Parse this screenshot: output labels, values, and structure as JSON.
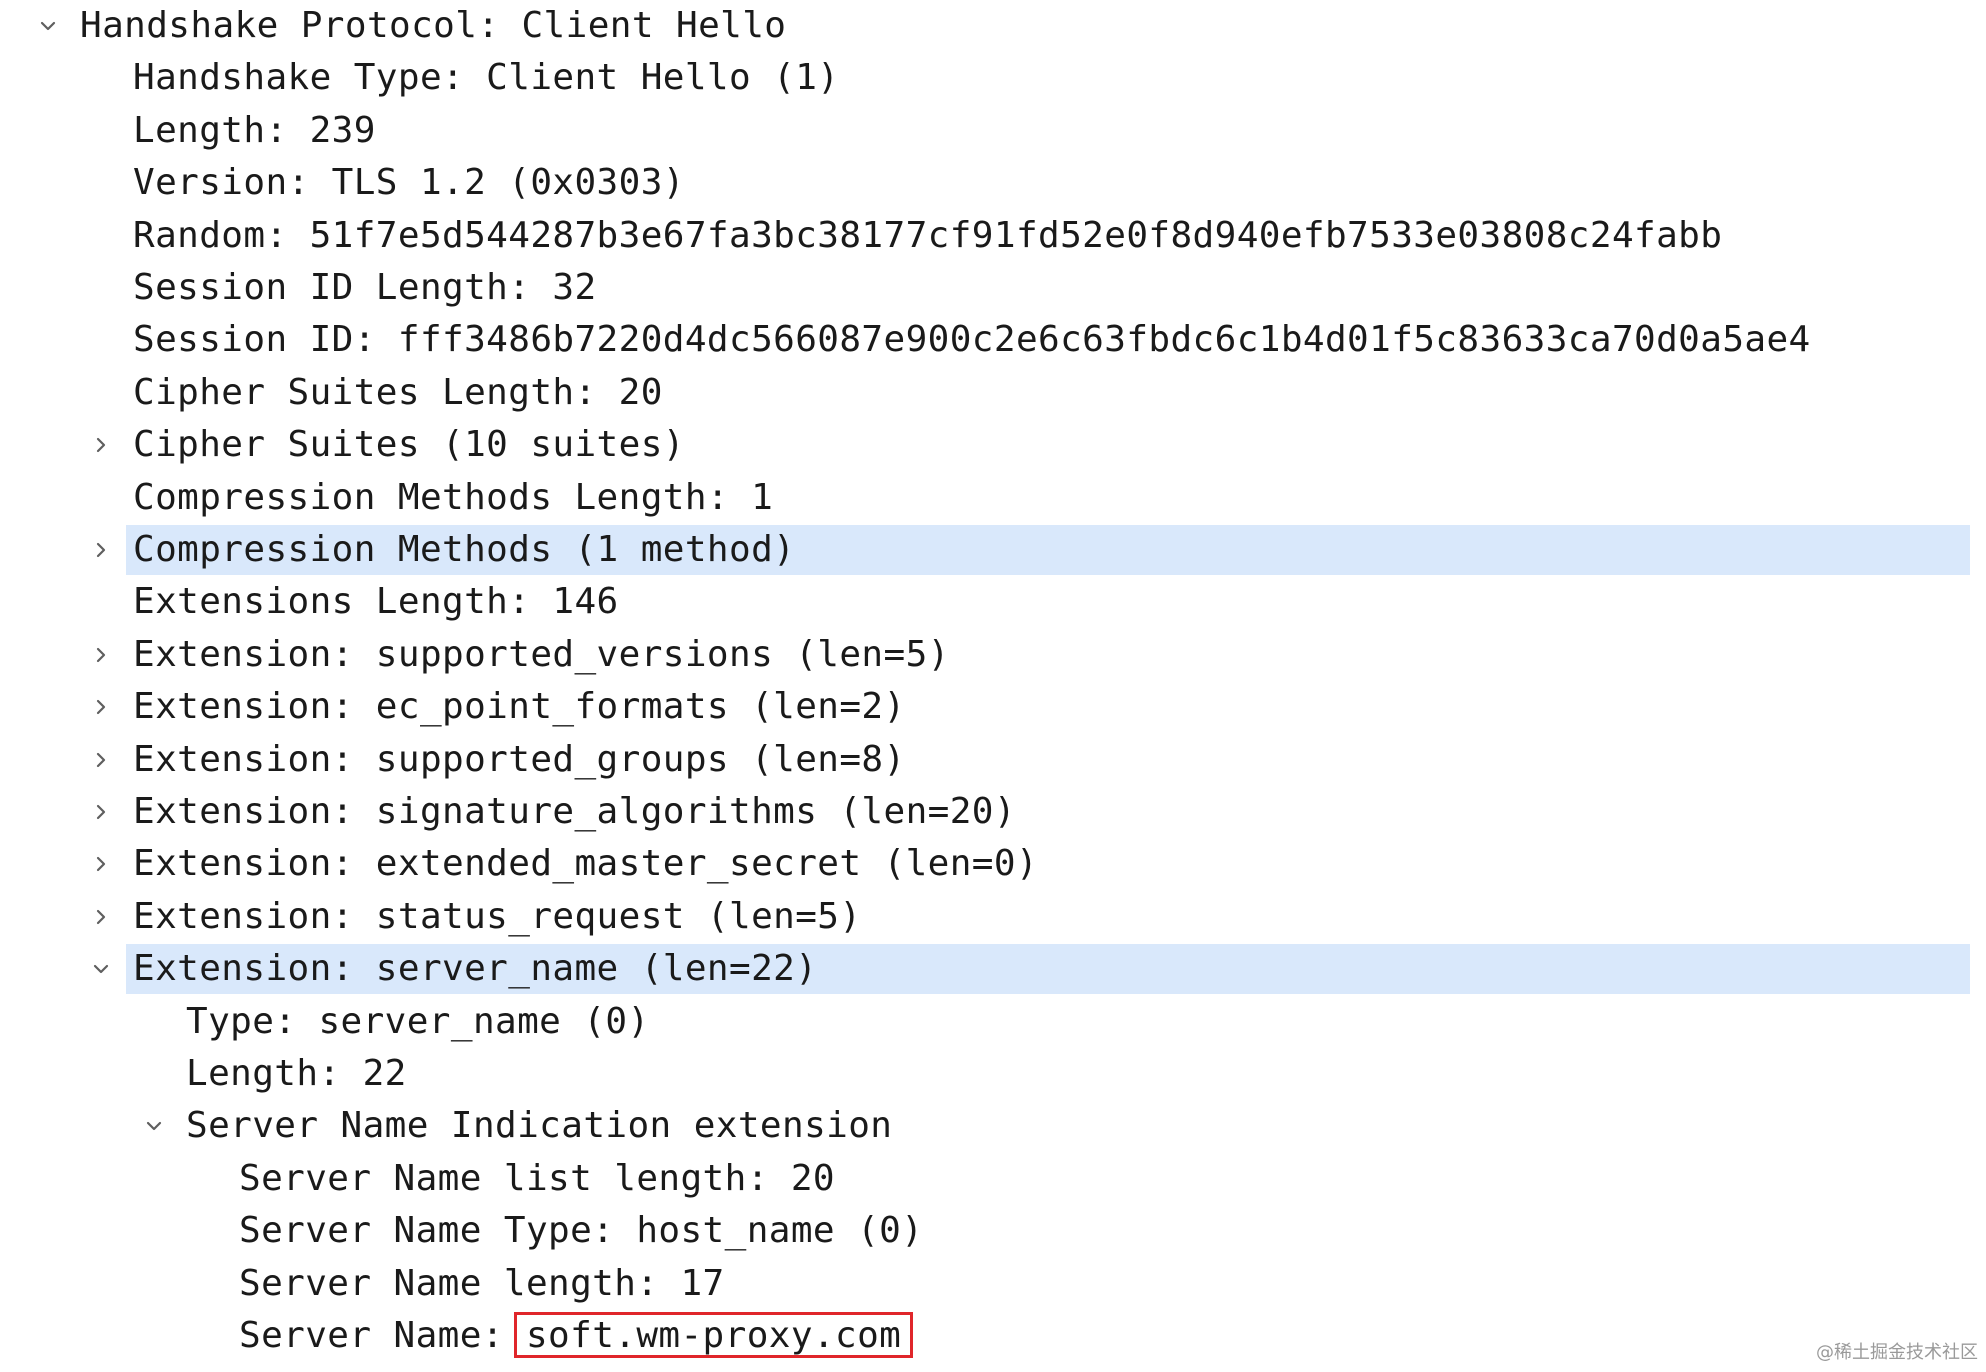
{
  "tree": [
    {
      "level": 0,
      "text": "Handshake Protocol: Client Hello",
      "toggle": "expanded",
      "selected": false
    },
    {
      "level": 1,
      "text": "Handshake Type: Client Hello (1)",
      "toggle": "none",
      "selected": false
    },
    {
      "level": 1,
      "text": "Length: 239",
      "toggle": "none",
      "selected": false
    },
    {
      "level": 1,
      "text": "Version: TLS 1.2 (0x0303)",
      "toggle": "none",
      "selected": false
    },
    {
      "level": 1,
      "text": "Random: 51f7e5d544287b3e67fa3bc38177cf91fd52e0f8d940efb7533e03808c24fabb",
      "toggle": "none",
      "selected": false
    },
    {
      "level": 1,
      "text": "Session ID Length: 32",
      "toggle": "none",
      "selected": false
    },
    {
      "level": 1,
      "text": "Session ID: fff3486b7220d4dc566087e900c2e6c63fbdc6c1b4d01f5c83633ca70d0a5ae4",
      "toggle": "none",
      "selected": false
    },
    {
      "level": 1,
      "text": "Cipher Suites Length: 20",
      "toggle": "none",
      "selected": false
    },
    {
      "level": 1,
      "text": "Cipher Suites (10 suites)",
      "toggle": "collapsed",
      "selected": false
    },
    {
      "level": 1,
      "text": "Compression Methods Length: 1",
      "toggle": "none",
      "selected": false
    },
    {
      "level": 1,
      "text": "Compression Methods (1 method)",
      "toggle": "collapsed",
      "selected": true
    },
    {
      "level": 1,
      "text": "Extensions Length: 146",
      "toggle": "none",
      "selected": false
    },
    {
      "level": 1,
      "text": "Extension: supported_versions (len=5)",
      "toggle": "collapsed",
      "selected": false
    },
    {
      "level": 1,
      "text": "Extension: ec_point_formats (len=2)",
      "toggle": "collapsed",
      "selected": false
    },
    {
      "level": 1,
      "text": "Extension: supported_groups (len=8)",
      "toggle": "collapsed",
      "selected": false
    },
    {
      "level": 1,
      "text": "Extension: signature_algorithms (len=20)",
      "toggle": "collapsed",
      "selected": false
    },
    {
      "level": 1,
      "text": "Extension: extended_master_secret (len=0)",
      "toggle": "collapsed",
      "selected": false
    },
    {
      "level": 1,
      "text": "Extension: status_request (len=5)",
      "toggle": "collapsed",
      "selected": false
    },
    {
      "level": 1,
      "text": "Extension: server_name (len=22)",
      "toggle": "expanded",
      "selected": true
    },
    {
      "level": 2,
      "text": "Type: server_name (0)",
      "toggle": "none",
      "selected": false
    },
    {
      "level": 2,
      "text": "Length: 22",
      "toggle": "none",
      "selected": false
    },
    {
      "level": 2,
      "text": "Server Name Indication extension",
      "toggle": "expanded",
      "selected": false
    },
    {
      "level": 3,
      "text": "Server Name list length: 20",
      "toggle": "none",
      "selected": false
    },
    {
      "level": 3,
      "text": "Server Name Type: host_name (0)",
      "toggle": "none",
      "selected": false
    },
    {
      "level": 3,
      "text": "Server Name length: 17",
      "toggle": "none",
      "selected": false
    },
    {
      "level": 3,
      "text": "Server Name: ",
      "value": "soft.wm-proxy.com",
      "toggle": "none",
      "selected": false,
      "highlighted_value": true
    }
  ],
  "watermark": "@稀土掘金技术社区",
  "colors": {
    "selection": "#d9e8fb",
    "highlight_box": "#e0262a",
    "text": "#1a1a1a",
    "toggle": "#5f5f5f"
  },
  "icons": {
    "expanded": "chevron-down-icon",
    "collapsed": "chevron-right-icon"
  }
}
